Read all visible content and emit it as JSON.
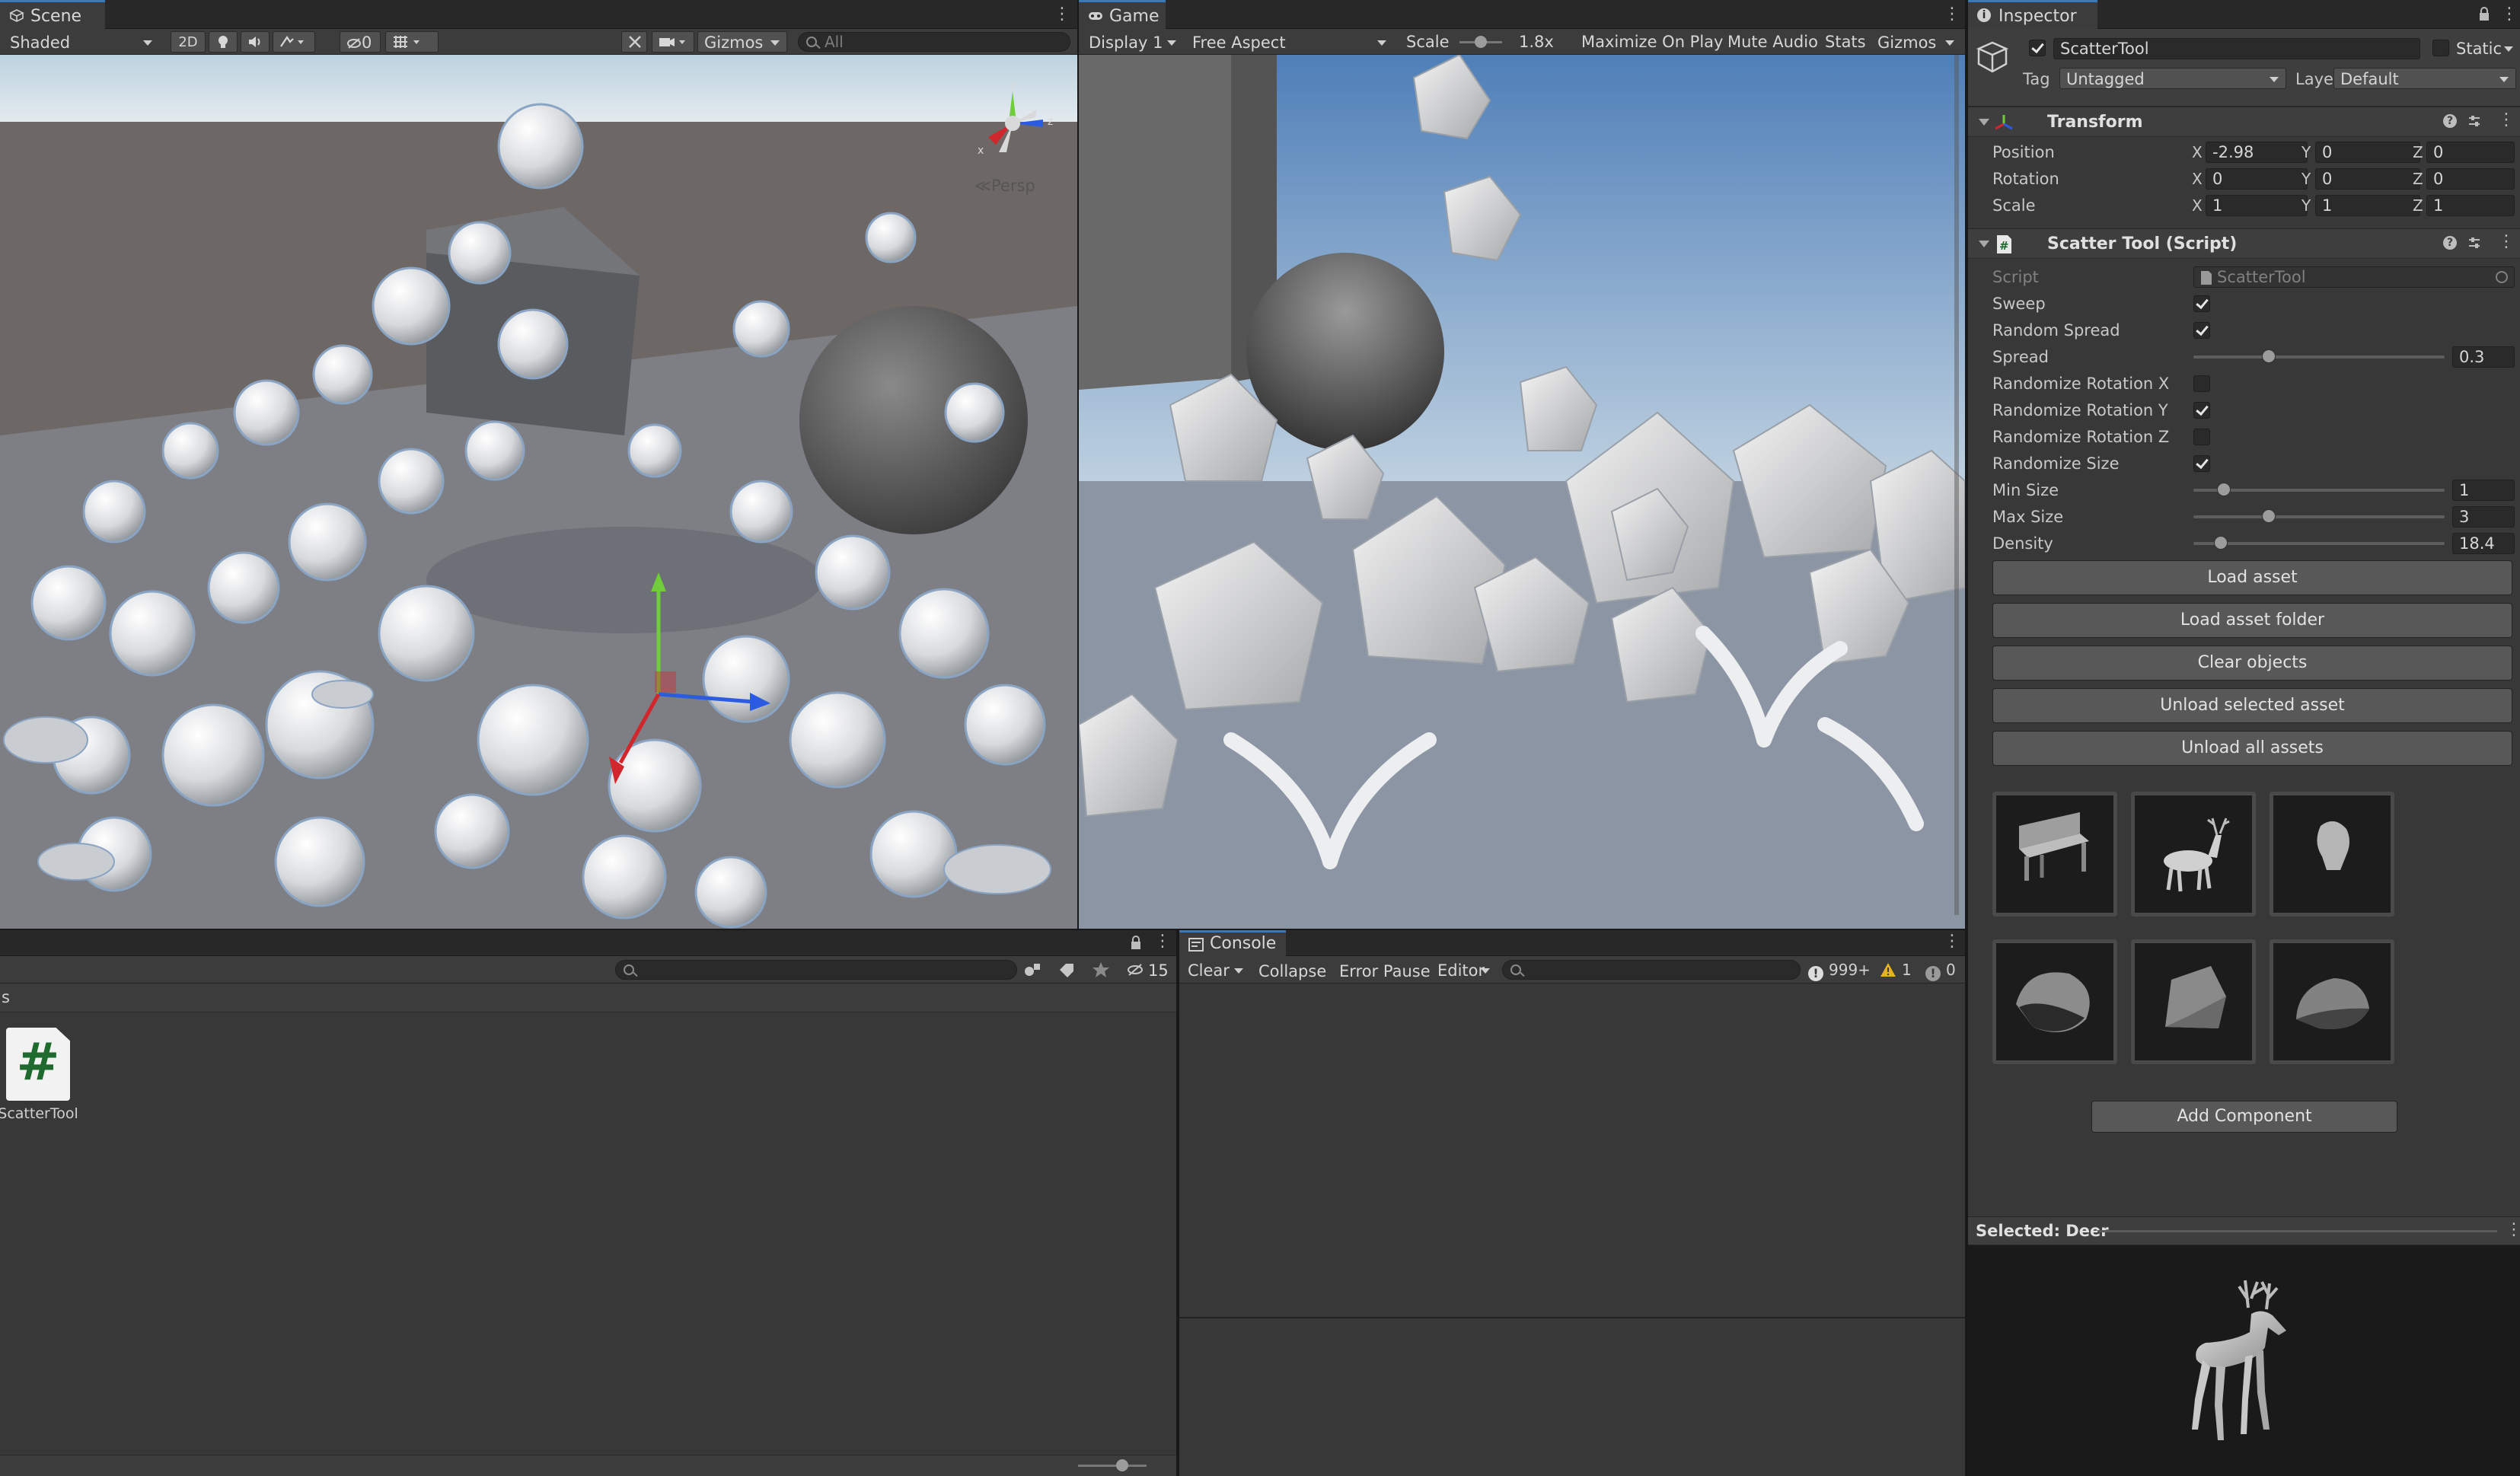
{
  "scene": {
    "tab_label": "Scene",
    "draw_mode": "Shaded",
    "btn_2d": "2D",
    "hidden_count": "0",
    "gizmos_label": "Gizmos",
    "search_placeholder": "All",
    "persp_label": "Persp",
    "gizmo_axes": {
      "y": "y",
      "x": "x",
      "z": "z"
    }
  },
  "game": {
    "tab_label": "Game",
    "display": "Display 1",
    "aspect": "Free Aspect",
    "scale_label": "Scale",
    "scale_value": "1.8x",
    "maximize": "Maximize On Play",
    "mute": "Mute Audio",
    "stats": "Stats",
    "gizmos": "Gizmos"
  },
  "project": {
    "hidden_count": "15",
    "breadcrumb": "s",
    "asset_name": "ScatterTool",
    "asset_glyph": "#"
  },
  "console": {
    "tab_label": "Console",
    "clear": "Clear",
    "collapse": "Collapse",
    "error_pause": "Error Pause",
    "editor": "Editor",
    "log_count": "999+",
    "warn_count": "1",
    "error_count": "0"
  },
  "inspector": {
    "tab_label": "Inspector",
    "object_name": "ScatterTool",
    "static_label": "Static",
    "tag_label": "Tag",
    "tag_value": "Untagged",
    "layer_label": "Layer",
    "layer_value": "Default",
    "transform": {
      "title": "Transform",
      "position_label": "Position",
      "rotation_label": "Rotation",
      "scale_label": "Scale",
      "position": {
        "x": "-2.98",
        "y": "0",
        "z": "0"
      },
      "rotation": {
        "x": "0",
        "y": "0",
        "z": "0"
      },
      "scale": {
        "x": "1",
        "y": "1",
        "z": "1"
      },
      "axis_x": "X",
      "axis_y": "Y",
      "axis_z": "Z"
    },
    "script": {
      "title": "Scatter Tool (Script)",
      "script_label": "Script",
      "script_value": "ScatterTool",
      "sweep_label": "Sweep",
      "sweep": true,
      "random_spread_label": "Random Spread",
      "random_spread": true,
      "spread_label": "Spread",
      "spread_value": "0.3",
      "spread_fraction": 0.3,
      "rot_x_label": "Randomize Rotation X",
      "rot_x": false,
      "rot_y_label": "Randomize Rotation Y",
      "rot_y": true,
      "rot_z_label": "Randomize Rotation Z",
      "rot_z": false,
      "rand_size_label": "Randomize Size",
      "rand_size": true,
      "min_size_label": "Min Size",
      "min_size_value": "1",
      "min_size_fraction": 0.12,
      "max_size_label": "Max Size",
      "max_size_value": "3",
      "max_size_fraction": 0.3,
      "density_label": "Density",
      "density_value": "18.4",
      "density_fraction": 0.11
    },
    "buttons": {
      "load_asset": "Load asset",
      "load_folder": "Load asset folder",
      "clear_objects": "Clear objects",
      "unload_selected": "Unload selected asset",
      "unload_all": "Unload all assets",
      "add_component": "Add Component"
    },
    "assets": [
      {
        "icon": "bench-icon"
      },
      {
        "icon": "deer-icon"
      },
      {
        "icon": "bust-icon"
      },
      {
        "icon": "rock-icon"
      },
      {
        "icon": "rock-icon"
      },
      {
        "icon": "rock-icon"
      }
    ],
    "selected_label": "Selected: Deer"
  },
  "colors": {
    "accent": "#3a79bb",
    "panel": "#383838",
    "tabbar": "#282828",
    "axis_x": "#d0262c",
    "axis_y": "#6fce3a",
    "axis_z": "#2b5be0"
  }
}
